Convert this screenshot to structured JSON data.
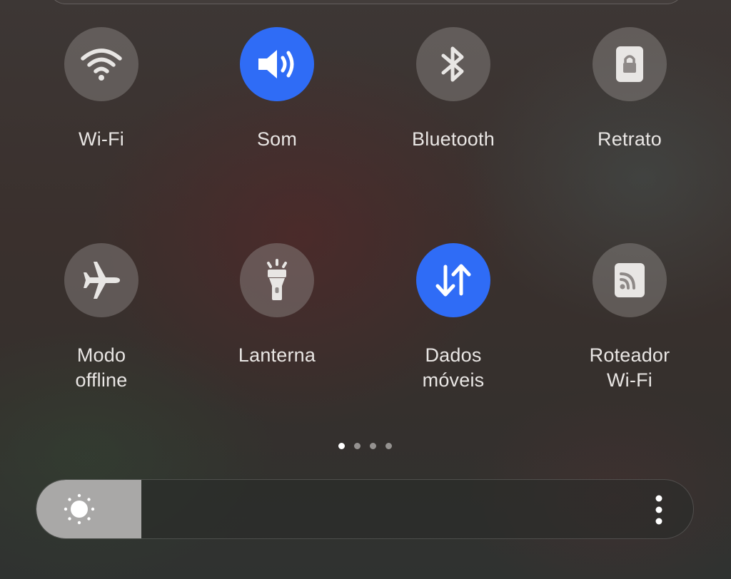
{
  "quick_settings": {
    "tiles": [
      {
        "label": "Wi-Fi",
        "icon": "wifi-icon",
        "active": false
      },
      {
        "label": "Som",
        "icon": "sound-icon",
        "active": true
      },
      {
        "label": "Bluetooth",
        "icon": "bluetooth-icon",
        "active": false
      },
      {
        "label": "Retrato",
        "icon": "portrait-lock-icon",
        "active": false
      },
      {
        "label": "Modo\noffline",
        "icon": "airplane-icon",
        "active": false
      },
      {
        "label": "Lanterna",
        "icon": "flashlight-icon",
        "active": false
      },
      {
        "label": "Dados\nmóveis",
        "icon": "mobile-data-icon",
        "active": true
      },
      {
        "label": "Roteador\nWi-Fi",
        "icon": "hotspot-icon",
        "active": false
      }
    ],
    "page_indicator": {
      "total": 4,
      "current": 1
    }
  },
  "brightness": {
    "level": 0.16,
    "icon": "sun-icon",
    "menu_icon": "more-vertical-icon"
  },
  "colors": {
    "active_tile": "#2f6cf6",
    "inactive_tile": "#8f8a88",
    "label_text": "#e9e6e4"
  }
}
